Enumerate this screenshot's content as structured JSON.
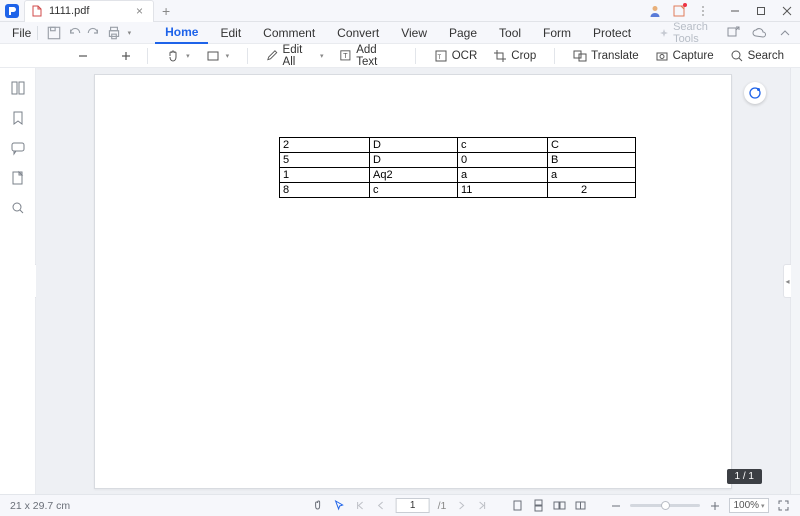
{
  "titlebar": {
    "tab_name": "1111.pdf",
    "notif_dot": true
  },
  "menubar": {
    "file": "File",
    "tabs": [
      "Home",
      "Edit",
      "Comment",
      "Convert",
      "View",
      "Page",
      "Tool",
      "Form",
      "Protect"
    ],
    "active_tab": "Home",
    "search_tools_placeholder": "Search Tools"
  },
  "toolbar": {
    "edit_all": "Edit All",
    "add_text": "Add Text",
    "ocr": "OCR",
    "crop": "Crop",
    "translate": "Translate",
    "capture": "Capture",
    "search": "Search"
  },
  "document": {
    "table": [
      [
        "2",
        "D",
        "c",
        "C"
      ],
      [
        "5",
        "D",
        "0",
        "B"
      ],
      [
        "1",
        "Aq2",
        "a",
        "a"
      ],
      [
        "8",
        "c",
        "11",
        "2"
      ]
    ],
    "indent_last_cell_row": 3
  },
  "page_indicator": "1 / 1",
  "statusbar": {
    "dimensions": "21 x 29.7 cm",
    "page_current": "1",
    "page_total": "/1",
    "zoom_percent": "100%",
    "zoom_thumb_pct": 50
  }
}
